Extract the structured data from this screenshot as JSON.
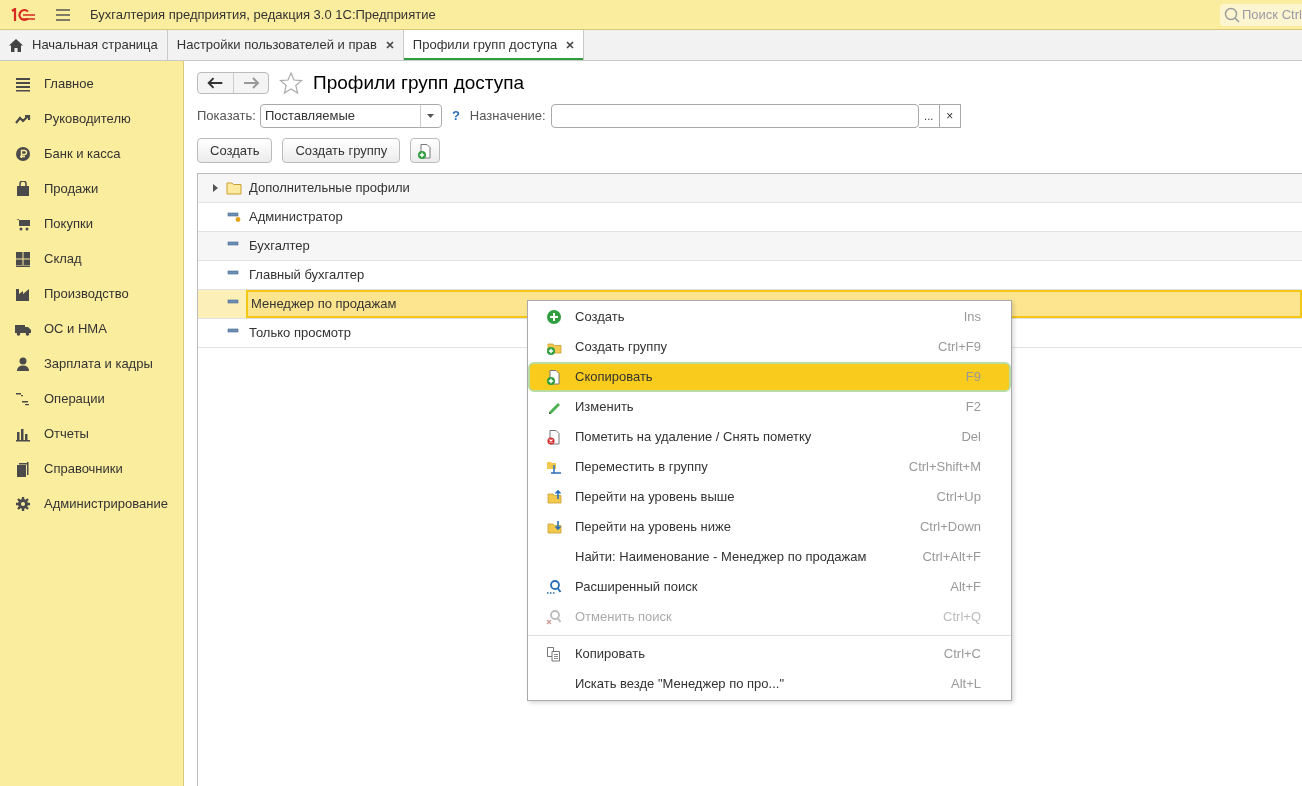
{
  "app": {
    "title": "Бухгалтерия предприятия, редакция 3.0 1С:Предприятие",
    "search": {
      "placeholder": "Поиск Ctrl"
    }
  },
  "tabs": [
    {
      "label": "Начальная страница",
      "kind": "home",
      "selected": false
    },
    {
      "label": "Настройки пользователей и прав",
      "kind": "closable",
      "selected": false
    },
    {
      "label": "Профили групп доступа",
      "kind": "closable",
      "selected": true
    }
  ],
  "sidebar": {
    "items": [
      {
        "label": "Главное"
      },
      {
        "label": "Руководителю"
      },
      {
        "label": "Банк и касса"
      },
      {
        "label": "Продажи"
      },
      {
        "label": "Покупки"
      },
      {
        "label": "Склад"
      },
      {
        "label": "Производство"
      },
      {
        "label": "ОС и НМА"
      },
      {
        "label": "Зарплата и кадры"
      },
      {
        "label": "Операции"
      },
      {
        "label": "Отчеты"
      },
      {
        "label": "Справочники"
      },
      {
        "label": "Администрирование"
      }
    ]
  },
  "page": {
    "title": "Профили групп доступа",
    "filters": {
      "show_label": "Показать:",
      "show_value": "Поставляемые",
      "help": "?",
      "purpose_label": "Назначение:",
      "ellipsis": "...",
      "clear": "×"
    },
    "buttons": [
      "Создать",
      "Создать группу"
    ],
    "rows": [
      {
        "label": "Дополнительные профили",
        "kind": "folder",
        "expanded": false,
        "selected": false
      },
      {
        "label": "Администратор",
        "kind": "item-dot",
        "selected": false
      },
      {
        "label": "Бухгалтер",
        "kind": "item",
        "selected": false
      },
      {
        "label": "Главный бухгалтер",
        "kind": "item",
        "selected": false
      },
      {
        "label": "Менеджер по продажам",
        "kind": "item",
        "selected": true
      },
      {
        "label": "Только просмотр",
        "kind": "item",
        "selected": false
      }
    ]
  },
  "context_menu": {
    "sections": [
      [
        {
          "label": "Создать",
          "shortcut": "Ins",
          "selected": false,
          "disabled": false
        },
        {
          "label": "Создать группу",
          "shortcut": "Ctrl+F9",
          "selected": false,
          "disabled": false
        },
        {
          "label": "Скопировать",
          "shortcut": "F9",
          "selected": true,
          "disabled": false
        },
        {
          "label": "Изменить",
          "shortcut": "F2",
          "selected": false,
          "disabled": false
        },
        {
          "label": "Пометить на удаление / Снять пометку",
          "shortcut": "Del",
          "selected": false,
          "disabled": false
        },
        {
          "label": "Переместить в группу",
          "shortcut": "Ctrl+Shift+M",
          "selected": false,
          "disabled": false
        },
        {
          "label": "Перейти на уровень выше",
          "shortcut": "Ctrl+Up",
          "selected": false,
          "disabled": false
        },
        {
          "label": "Перейти на уровень ниже",
          "shortcut": "Ctrl+Down",
          "selected": false,
          "disabled": false
        },
        {
          "label": "Найти: Наименование - Менеджер по продажам",
          "shortcut": "Ctrl+Alt+F",
          "selected": false,
          "disabled": false
        },
        {
          "label": "Расширенный поиск",
          "shortcut": "Alt+F",
          "selected": false,
          "disabled": false
        },
        {
          "label": "Отменить поиск",
          "shortcut": "Ctrl+Q",
          "selected": false,
          "disabled": true
        }
      ],
      [
        {
          "label": "Копировать",
          "shortcut": "Ctrl+C",
          "selected": false,
          "disabled": false
        },
        {
          "label": "Искать везде \"Менеджер по про...\"",
          "shortcut": "Alt+L",
          "selected": false,
          "disabled": false
        }
      ]
    ]
  }
}
